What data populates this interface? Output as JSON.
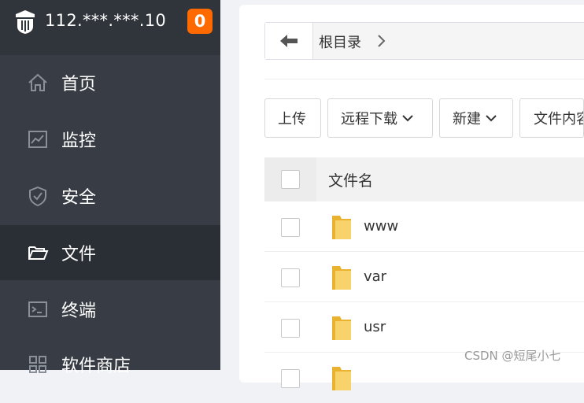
{
  "sidebar": {
    "host": "112.***.***.10",
    "badge": "0",
    "items": [
      {
        "label": "首页"
      },
      {
        "label": "监控"
      },
      {
        "label": "安全"
      },
      {
        "label": "文件"
      },
      {
        "label": "终端"
      },
      {
        "label": "软件商店"
      }
    ]
  },
  "path": {
    "root": "根目录"
  },
  "toolbar": {
    "upload": "上传",
    "remote_download": "远程下载",
    "new": "新建",
    "file_content": "文件内容"
  },
  "table": {
    "header": "文件名",
    "rows": [
      {
        "name": "www"
      },
      {
        "name": "var"
      },
      {
        "name": "usr"
      }
    ]
  },
  "watermark": "CSDN @短尾小七",
  "colors": {
    "sidebar": "#383d45",
    "active": "#2a2e35",
    "badge": "#ff6a00",
    "folder": "#f5c342"
  }
}
